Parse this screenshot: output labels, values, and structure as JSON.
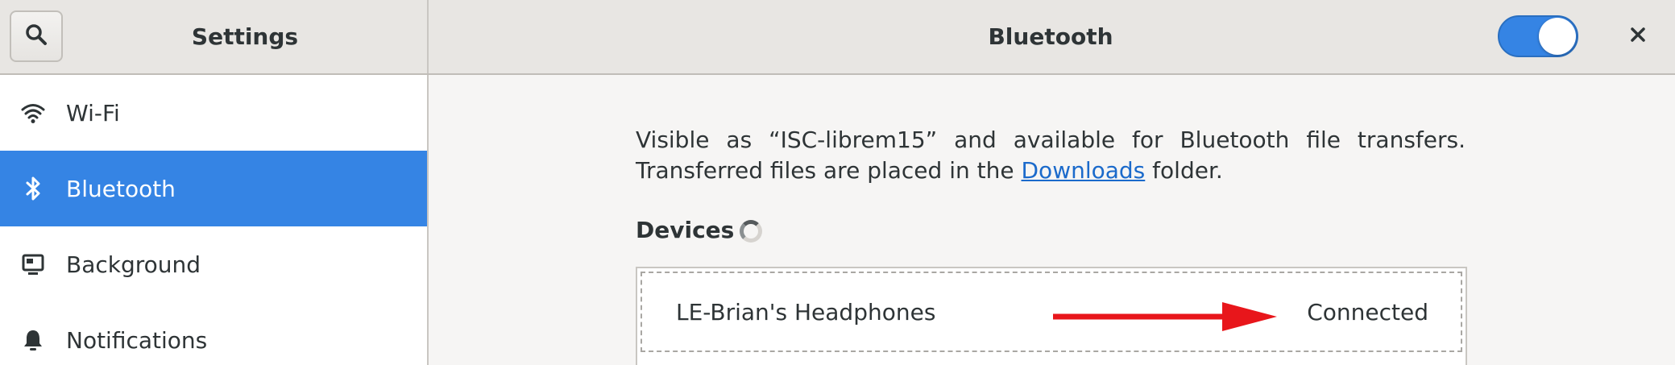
{
  "header": {
    "search_icon": "search-icon",
    "app_title": "Settings",
    "page_title": "Bluetooth",
    "bluetooth_toggle_on": true,
    "close_icon": "close-icon"
  },
  "sidebar": {
    "items": [
      {
        "label": "Wi-Fi",
        "icon": "wifi-icon",
        "selected": false
      },
      {
        "label": "Bluetooth",
        "icon": "bluetooth-icon",
        "selected": true
      },
      {
        "label": "Background",
        "icon": "background-icon",
        "selected": false
      },
      {
        "label": "Notifications",
        "icon": "bell-icon",
        "selected": false
      }
    ]
  },
  "main": {
    "info_line1": "Visible as “ISC-librem15” and available for Bluetooth file transfers.",
    "info_line2_before": "Transferred files are placed in the ",
    "info_link": "Downloads",
    "info_line2_after": " folder.",
    "devices_heading": "Devices",
    "devices": [
      {
        "name": "LE-Brian's Headphones",
        "status": "Connected"
      }
    ]
  },
  "colors": {
    "accent": "#3584e4",
    "annotation_arrow": "#e8161b",
    "link": "#1b6acb"
  }
}
